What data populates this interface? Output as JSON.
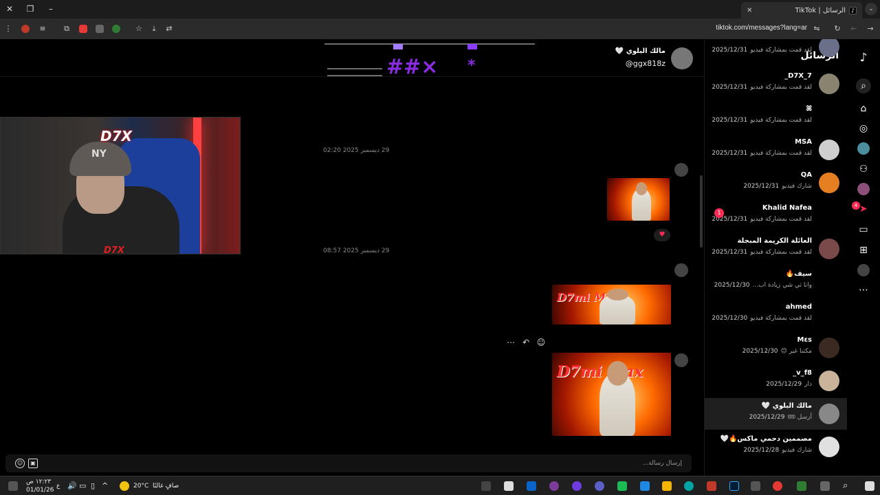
{
  "browser": {
    "tab_title": "الرسائل | TikTok",
    "tab_favicon": "tiktok-icon",
    "url": "tiktok.com/messages?lang=ar"
  },
  "rail": {
    "icons": [
      "tiktok-logo-icon",
      "search-icon",
      "home-icon",
      "explore-icon",
      "profile-avatar-icon",
      "friends-icon",
      "live-icon",
      "activity-icon",
      "messages-icon",
      "upload-icon",
      "profile-icon",
      "more-icon"
    ],
    "activity_badge": "4"
  },
  "conversations": {
    "title": "الرسائل",
    "items": [
      {
        "name": "",
        "preview": "لقد قمت بمشاركة فيديو",
        "date": "2025/12/31",
        "partial": true
      },
      {
        "name": "D7X_7_",
        "preview": "لقد قمت بمشاركة فيديو",
        "date": "2025/12/31"
      },
      {
        "name": "ꕤ",
        "preview": "لقد قمت بمشاركة فيديو",
        "date": "2025/12/31"
      },
      {
        "name": "MSA",
        "preview": "لقد قمت بمشاركة فيديو",
        "date": "2025/12/31"
      },
      {
        "name": "QA",
        "preview": "شارك فيديو",
        "date": "2025/12/31"
      },
      {
        "name": "Khalid Nafea",
        "preview": "لقد قمت بمشاركة فيديو",
        "date": "2025/12/31",
        "unread": "1"
      },
      {
        "name": "العائلة الكريمة المبجلة",
        "preview": "لقد قمت بمشاركة فيديو",
        "date": "2025/12/31"
      },
      {
        "name": "سيف🔥",
        "preview": "وانا ثي شي زيادة اب...",
        "date": "2025/12/30"
      },
      {
        "name": "ahmed",
        "preview": "لقد قمت بمشاركة فيديو",
        "date": "2025/12/30"
      },
      {
        "name": "Mεs",
        "preview": "مكتنا غير 😊",
        "date": "2025/12/30"
      },
      {
        "name": "v_f8_",
        "preview": "دار",
        "date": "2025/12/29"
      },
      {
        "name": "مالك البلوي 🤍",
        "preview": "أرسل 🎟",
        "date": "2025/12/29",
        "active": true
      },
      {
        "name": "مصممين دحمي ماكس🔥🤍",
        "preview": "شارك فيديو",
        "date": "2025/12/28"
      }
    ]
  },
  "chat": {
    "header_name": "مالك البلوي 🤍",
    "header_handle": "@ggx818z",
    "timestamps": [
      "29 ديسمبر 2025 02:20",
      "29 ديسمبر 2025 08:57"
    ],
    "reaction": "♥",
    "composer_placeholder": "إرسال رسالة...",
    "thumb_logo": "D7mi Max"
  },
  "cam": {
    "brand_top": "D7X",
    "brand_bottom": "D7X",
    "cap_logo": "NY"
  },
  "taskbar": {
    "time": "١٢:٢٣ ص",
    "date": "01/01/26",
    "weather_temp": "20°C",
    "weather_text": "صافٍ غالبًا",
    "lang": "ع"
  }
}
